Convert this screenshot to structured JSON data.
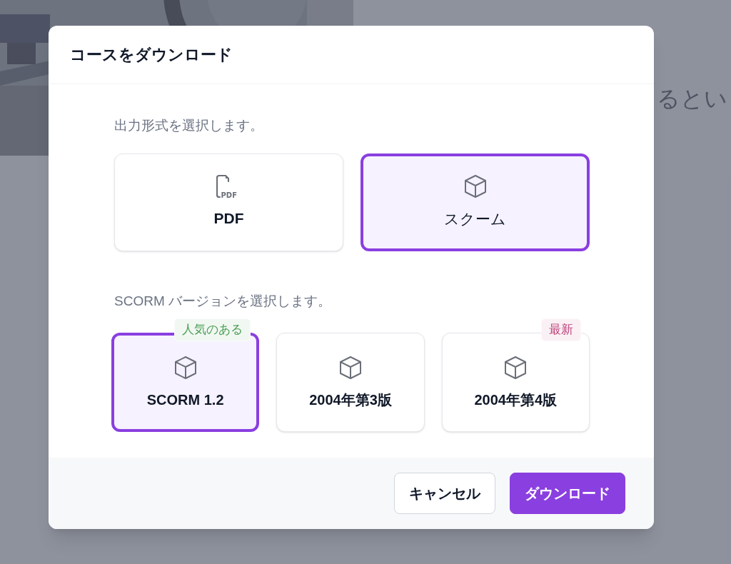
{
  "background": {
    "text": "るとい"
  },
  "dialog": {
    "title": "コースをダウンロード"
  },
  "format_section": {
    "label": "出力形式を選択します。",
    "options": [
      {
        "label": "PDF",
        "kind": "pdf",
        "icon_text": "PDF",
        "selected": false
      },
      {
        "label": "スクーム",
        "kind": "cube",
        "selected": true
      }
    ]
  },
  "version_section": {
    "label": "SCORM バージョンを選択します。",
    "options": [
      {
        "label": "SCORM 1.2",
        "selected": true,
        "badge": {
          "text": "人気のある",
          "color": "#4c9f57"
        }
      },
      {
        "label": "2004年第3版",
        "selected": false
      },
      {
        "label": "2004年第4版",
        "selected": false,
        "badge": {
          "text": "最新",
          "color": "#c0467c"
        }
      }
    ]
  },
  "buttons": [
    {
      "label": "キャンセル",
      "kind": "secondary"
    },
    {
      "label": "ダウンロード",
      "kind": "primary"
    }
  ]
}
